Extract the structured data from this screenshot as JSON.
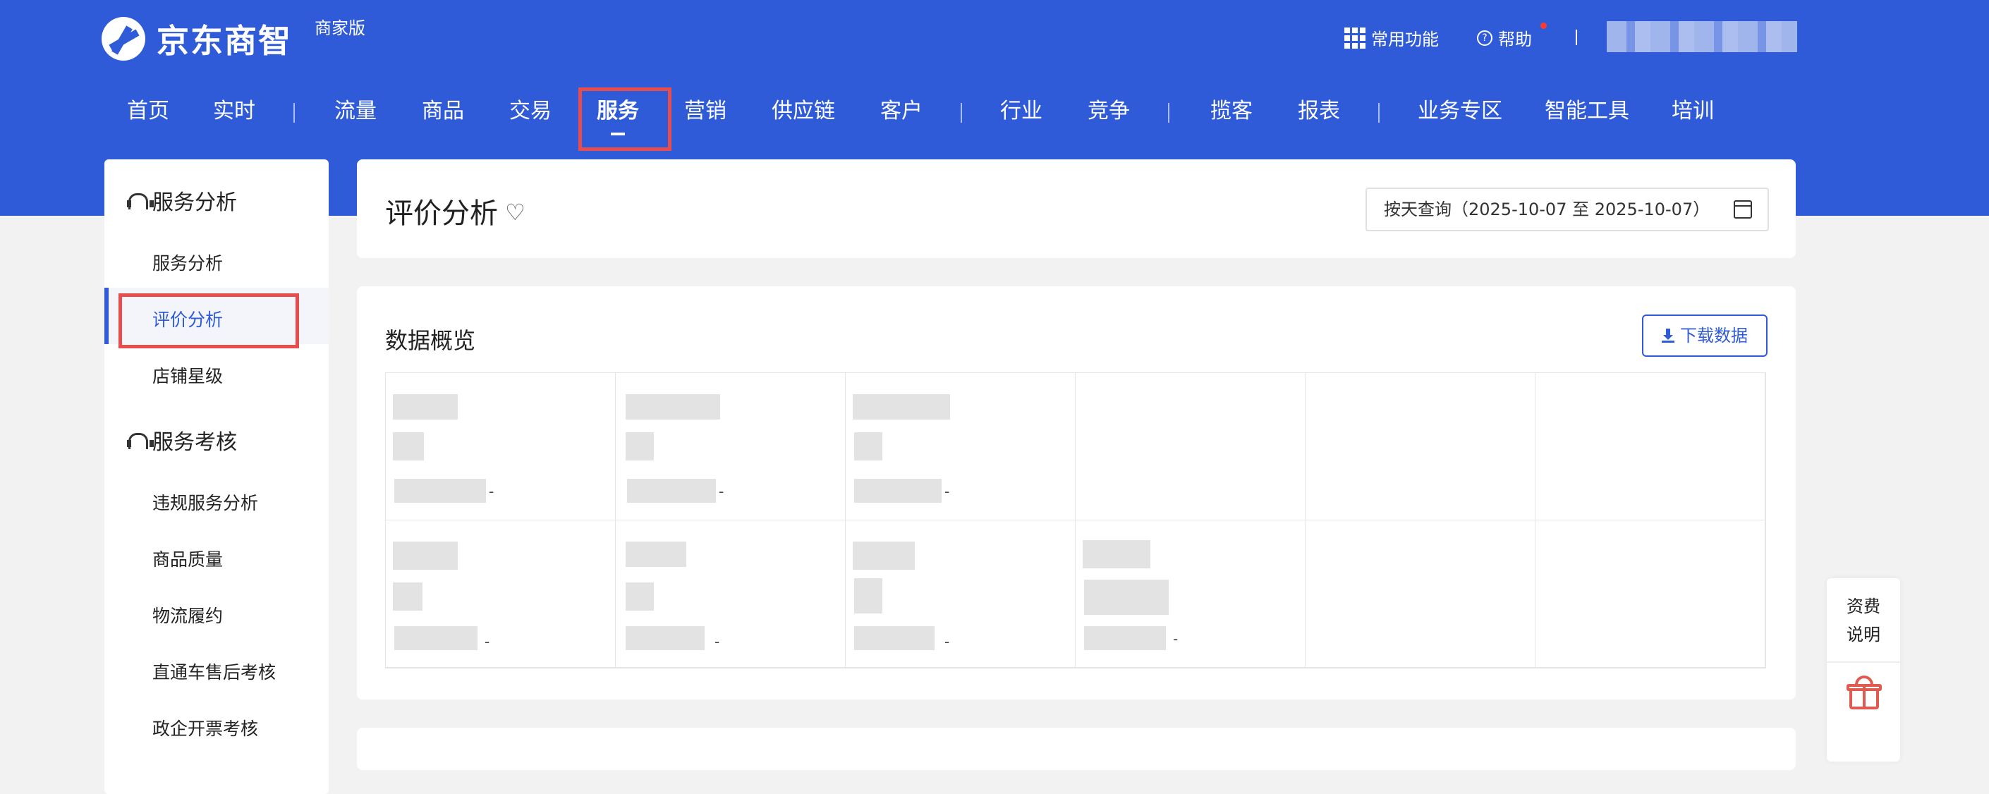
{
  "header": {
    "brand": "京东商智",
    "edition": "商家版",
    "common_functions": "常用功能",
    "help": "帮助"
  },
  "nav": {
    "items": [
      "首页",
      "实时",
      "流量",
      "商品",
      "交易",
      "服务",
      "营销",
      "供应链",
      "客户",
      "行业",
      "竞争",
      "揽客",
      "报表",
      "业务专区",
      "智能工具",
      "培训"
    ],
    "active": "服务"
  },
  "sidebar": {
    "sections": [
      {
        "title": "服务分析",
        "items": [
          "服务分析",
          "评价分析",
          "店铺星级"
        ]
      },
      {
        "title": "服务考核",
        "items": [
          "违规服务分析",
          "商品质量",
          "物流履约",
          "直通车售后考核",
          "政企开票考核"
        ]
      }
    ],
    "active_item": "评价分析"
  },
  "page": {
    "title": "评价分析",
    "date_query": "按天查询（2025-10-07 至 2025-10-07）"
  },
  "overview": {
    "title": "数据概览",
    "download_label": "下载数据",
    "dash": "-"
  },
  "floatbar": {
    "fee_line1": "资费",
    "fee_line2": "说明"
  },
  "colors": {
    "primary": "#2f5bd8",
    "highlight": "#e84d4d",
    "gift": "#e05a4f"
  },
  "icons": [
    "logo-icon",
    "grid-icon",
    "help-icon",
    "headset-icon",
    "heart-icon",
    "calendar-icon",
    "download-icon",
    "gift-icon"
  ]
}
